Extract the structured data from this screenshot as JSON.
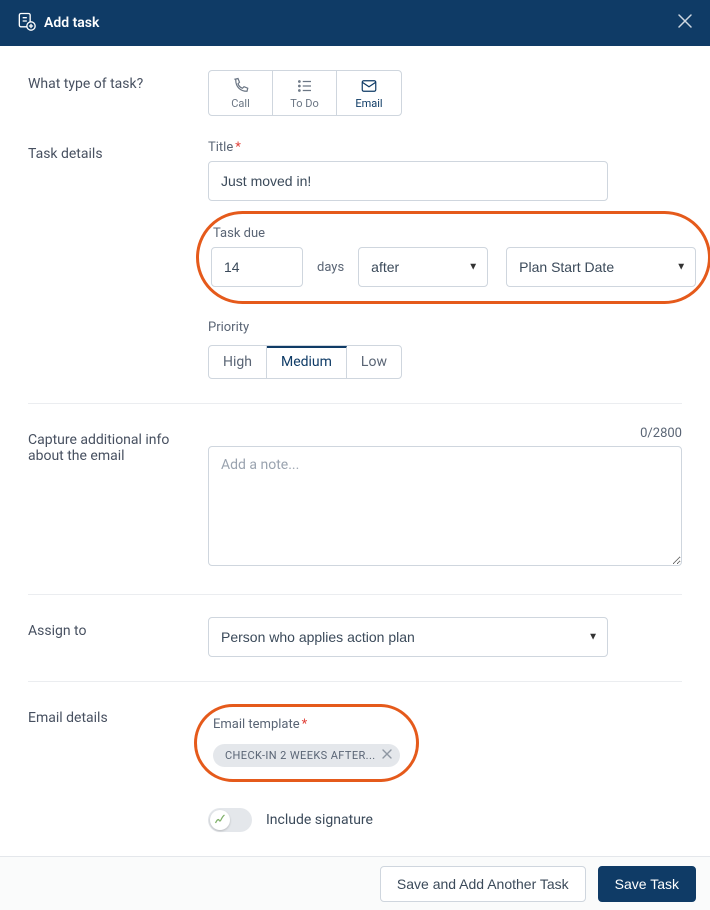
{
  "header": {
    "title": "Add task"
  },
  "task_type": {
    "label": "What type of task?",
    "options": [
      "Call",
      "To Do",
      "Email"
    ],
    "selected": "Email"
  },
  "details": {
    "section_label": "Task details",
    "title_label": "Title",
    "title_value": "Just moved in!",
    "due_label": "Task due",
    "due_number": "14",
    "due_unit": "days",
    "due_relation": "after",
    "due_reference": "Plan Start Date",
    "priority_label": "Priority",
    "priority_options": [
      "High",
      "Medium",
      "Low"
    ],
    "priority_selected": "Medium"
  },
  "note": {
    "label": "Capture additional info about the email",
    "placeholder": "Add a note...",
    "count": "0/2800"
  },
  "assign": {
    "label": "Assign to",
    "value": "Person who applies action plan"
  },
  "email": {
    "label": "Email details",
    "template_label": "Email template",
    "template_chip": "CHECK-IN 2 WEEKS AFTER...",
    "signature_label": "Include signature"
  },
  "footer": {
    "secondary": "Save and Add Another Task",
    "primary": "Save Task"
  }
}
